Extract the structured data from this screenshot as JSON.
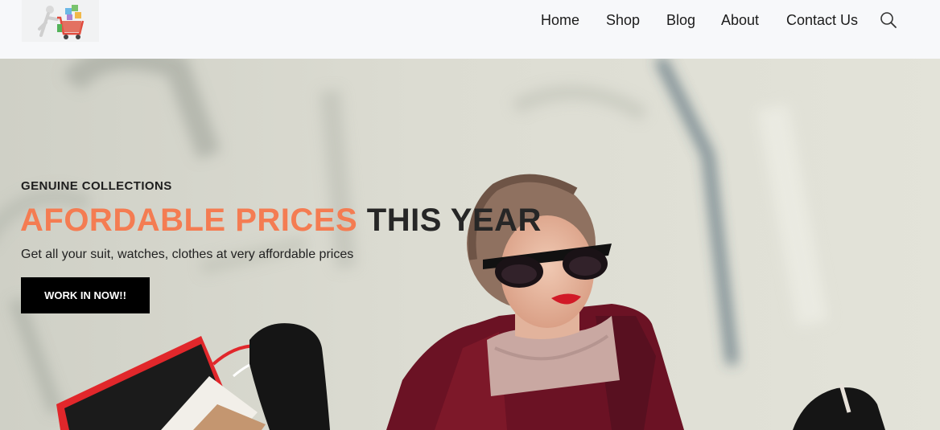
{
  "header": {
    "nav": [
      {
        "label": "Home"
      },
      {
        "label": "Shop"
      },
      {
        "label": "Blog"
      },
      {
        "label": "About"
      },
      {
        "label": "Contact Us"
      }
    ],
    "search_icon": "search-icon",
    "logo_icon": "shopping-cart-logo"
  },
  "hero": {
    "kicker": "GENUINE COLLECTIONS",
    "headline_accent": "AFORDABLE PRICES",
    "headline_dark": "THIS YEAR",
    "subtext": "Get all your suit, watches, clothes at very affordable prices",
    "cta_label": "WORK IN NOW!!",
    "colors": {
      "accent": "#f47c52",
      "cta_bg": "#000000",
      "header_bg": "#f7f8fa"
    }
  }
}
